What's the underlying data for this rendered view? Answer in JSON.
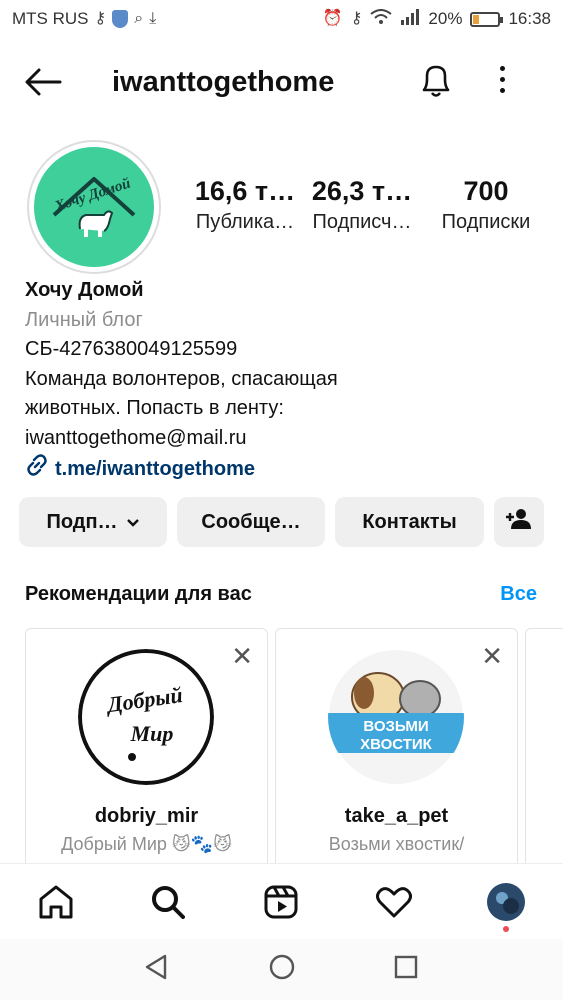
{
  "status_bar": {
    "carrier": "MTS RUS",
    "battery": "20%",
    "battery_level": 0.2,
    "time": "16:38"
  },
  "header": {
    "username": "iwanttogethome"
  },
  "profile": {
    "avatar_text": "Хочу Домой",
    "stats": [
      {
        "value": "16,6 т…",
        "label": "Публика…"
      },
      {
        "value": "26,3 т…",
        "label": "Подписч…"
      },
      {
        "value": "700",
        "label": "Подписки"
      }
    ],
    "name": "Хочу Домой",
    "category": "Личный блог",
    "bio_lines": [
      "СБ-4276380049125599",
      "Команда волонтеров, спасающая",
      "животных. Попасть в ленту:",
      "iwanttogethome@mail.ru"
    ],
    "link": "t.me/iwanttogethome"
  },
  "actions": {
    "subscribe_label": "Подп…",
    "message_label": "Сообще…",
    "contacts_label": "Контакты"
  },
  "recommendations": {
    "title": "Рекомендации для вас",
    "see_all": "Все",
    "cards": [
      {
        "username": "dobriy_mir",
        "full_name": "Добрый Мир 😼🐾😼",
        "logo_line1": "Добрый",
        "logo_line2": "Мир"
      },
      {
        "username": "take_a_pet",
        "full_name": "Возьми хвостик/",
        "logo_line1": "ВОЗЬМИ",
        "logo_line2": "ХВОСТИК"
      }
    ]
  },
  "colors": {
    "accent": "#0095f6",
    "link": "#00376b",
    "avatar_bg": "#3fcf9a",
    "button_bg": "#efefef"
  }
}
